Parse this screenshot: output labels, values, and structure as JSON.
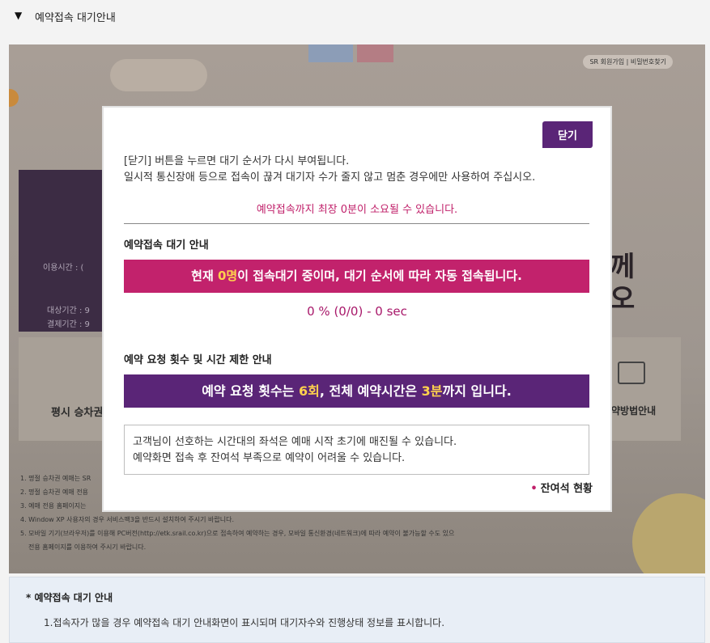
{
  "header": {
    "toggle_icon": "triangle-down-icon",
    "title": "예약접속 대기안내"
  },
  "background": {
    "sr_links": "SR 회원가입 | 비밀번호찾기",
    "left_rows": [
      "이용시간 : (",
      "(",
      "(",
      "대상기간 : 9",
      "결제기간 : 9"
    ],
    "card_left_label": "평시 승차권",
    "card_right_label": "약방법안내",
    "big_text_1": "께",
    "big_text_2": "오",
    "notes": [
      "1. 명절 승차권 예매는 SR",
      "2. 명절 승차권 예매 전용",
      "3. 예매 전용 홈페이지는",
      "4. Window XP 사용자의 경우 서비스팩3을 반드시 설치하여 주시기 바랍니다.",
      "5. 모바일 기기(브라우저)를 이용해 PC버전(http://etk.srail.co.kr)으로 접속하여 예약하는 경우, 모바일 통신환경(네트워크)에 따라 예약이 불가능할 수도 있으",
      "   전용 홈페이지를 이용하여 주시기 바랍니다."
    ]
  },
  "modal": {
    "close_label": "닫기",
    "notice_line1": "[닫기] 버튼을 누르면 대기 순서가 다시 부여됩니다.",
    "notice_line2": "일시적 통신장애 등으로 접속이 끊겨 대기자 수가 줄지 않고 멈춘 경우에만 사용하여 주십시오.",
    "max_time": "예약접속까지 최장 0분이 소요될 수 있습니다.",
    "wait_section_title": "예약접속 대기 안내",
    "wait_banner_prefix": "현재 ",
    "wait_banner_count": "0명",
    "wait_banner_suffix": "이 접속대기 중이며, 대기 순서에 따라 자동 접속됩니다.",
    "progress": "0 % (0/0) - 0 sec",
    "limit_section_title": "예약 요청 횟수 및 시간 제한 안내",
    "limit_banner_p1": "예약 요청 횟수는 ",
    "limit_banner_count": "6회",
    "limit_banner_p2": ", 전체 예약시간은 ",
    "limit_banner_time": "3분",
    "limit_banner_p3": "까지 입니다.",
    "info_line1": "고객님이 선호하는 시간대의 좌석은 예매 시작 초기에 매진될 수 있습니다.",
    "info_line2": "예약화면 접속 후 잔여석 부족으로 예약이 어려울 수 있습니다.",
    "remain_bullet": "•",
    "remain_label": "잔여석 현황"
  },
  "footer": {
    "title": "* 예약접속 대기 안내",
    "line1": "1.접속자가 많을 경우 예약접속 대기 안내화면이 표시되며 대기자수와 진행상태 정보를 표시합니다."
  },
  "colors": {
    "purple": "#5a2577",
    "pink": "#c2226c",
    "highlight": "#ffd24d"
  }
}
